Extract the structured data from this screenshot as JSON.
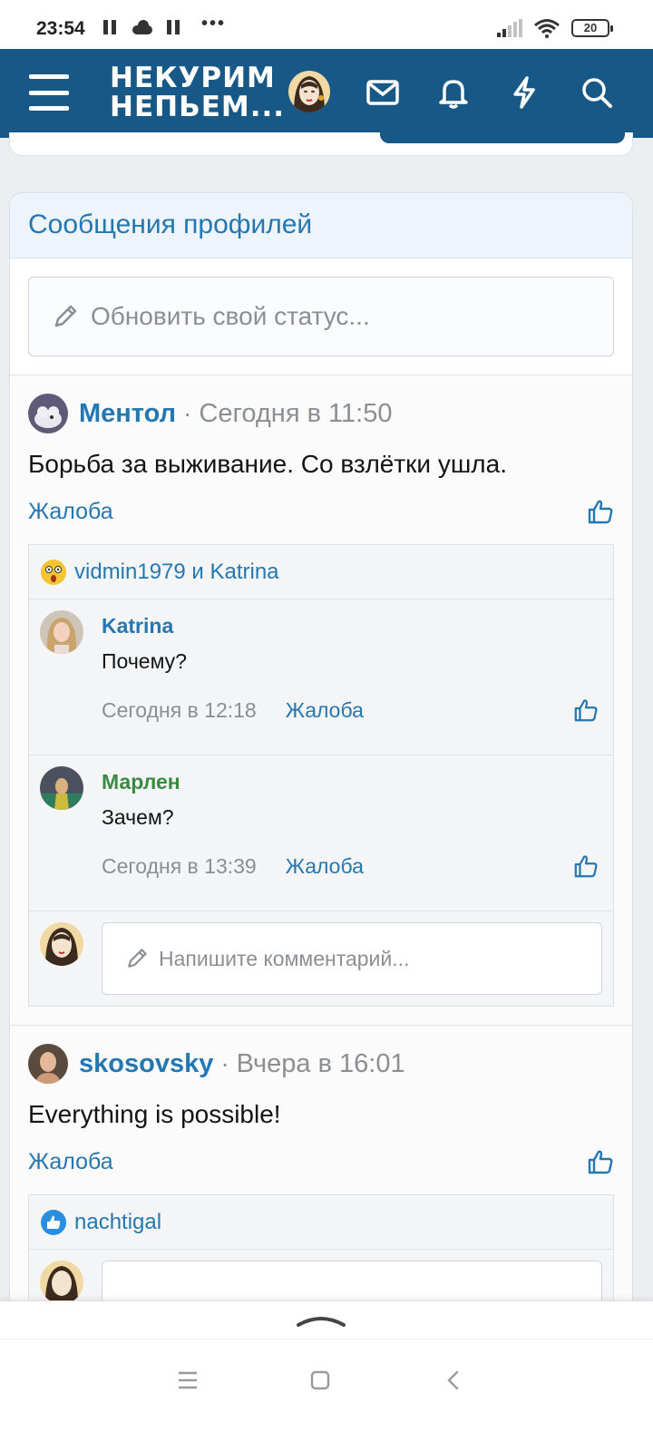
{
  "status_bar": {
    "time": "23:54",
    "battery": "20",
    "icons": [
      "pause-icon",
      "cloud-icon",
      "pause-icon",
      "more-dots-icon",
      "signal-icon",
      "wifi-icon",
      "battery-icon"
    ]
  },
  "header": {
    "logo_line1": "НЕКУРИМ",
    "logo_line2": "НЕПЬЕМ...",
    "icons": [
      "menu-icon",
      "avatar",
      "mail-icon",
      "bell-icon",
      "bolt-icon",
      "search-icon"
    ],
    "color": "#185886"
  },
  "profile_posts": {
    "title": "Сообщения профилей",
    "status_placeholder": "Обновить свой статус...",
    "posts": [
      {
        "user": "Ментол",
        "separator": "·",
        "time": "Сегодня в 11:50",
        "text": "Борьба за выживание. Со взлётки ушла.",
        "report": "Жалоба",
        "reactions": "vidmin1979 и Katrina",
        "comments": [
          {
            "user": "Katrina",
            "text": "Почему?",
            "time": "Сегодня в 12:18",
            "report": "Жалоба"
          },
          {
            "user": "Марлен",
            "text": "Зачем?",
            "time": "Сегодня в 13:39",
            "report": "Жалоба"
          }
        ],
        "comment_placeholder": "Напишите комментарий..."
      },
      {
        "user": "skosovsky",
        "separator": "·",
        "time": "Вчера в 16:01",
        "text": "Everything is possible!",
        "report": "Жалоба",
        "reactions": "nachtigal"
      }
    ]
  },
  "colors": {
    "link": "#2577b1",
    "green_user": "#3a8a43",
    "muted": "#8b8f93"
  }
}
